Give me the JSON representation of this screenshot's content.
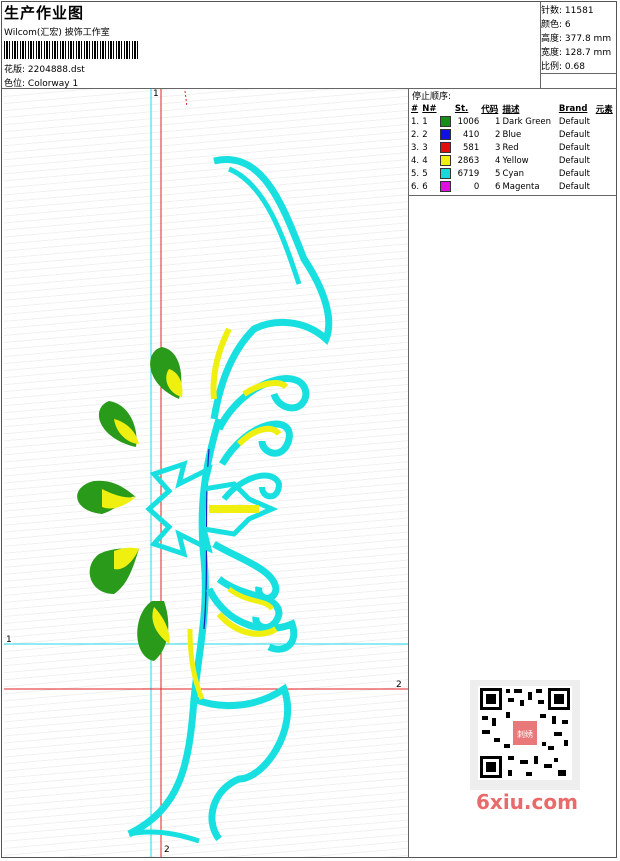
{
  "header": {
    "title": "生产作业图",
    "studio": "Wilcom(汇宏) 披饰工作室",
    "design_label": "花版:",
    "design_file": "2204888.dst",
    "colorway_label": "色位:",
    "colorway": "Colorway 1"
  },
  "stats": {
    "stitches_label": "针数:",
    "stitches": "11581",
    "colors_label": "颜色:",
    "colors": "6",
    "height_label": "高度:",
    "height": "377.8 mm",
    "width_label": "宽度:",
    "width": "128.7 mm",
    "scale_label": "比例:",
    "scale": "0.68"
  },
  "stop_sequence": {
    "title": "停止顺序:",
    "columns": [
      "#",
      "N#",
      "St.",
      "代码",
      "描述",
      "Brand",
      "元素"
    ],
    "rows": [
      {
        "idx": "1.",
        "n": "1",
        "color": "#1a8c1a",
        "st": "1006",
        "code": "1",
        "desc": "Dark Green",
        "brand": "Default"
      },
      {
        "idx": "2.",
        "n": "2",
        "color": "#1010e0",
        "st": "410",
        "code": "2",
        "desc": "Blue",
        "brand": "Default"
      },
      {
        "idx": "3.",
        "n": "3",
        "color": "#e01010",
        "st": "581",
        "code": "3",
        "desc": "Red",
        "brand": "Default"
      },
      {
        "idx": "4.",
        "n": "4",
        "color": "#f0f010",
        "st": "2863",
        "code": "4",
        "desc": "Yellow",
        "brand": "Default"
      },
      {
        "idx": "5.",
        "n": "5",
        "color": "#18d8d8",
        "st": "6719",
        "code": "5",
        "desc": "Cyan",
        "brand": "Default"
      },
      {
        "idx": "6.",
        "n": "6",
        "color": "#e010e0",
        "st": "0",
        "code": "6",
        "desc": "Magenta",
        "brand": "Default"
      }
    ]
  },
  "axes": {
    "v1": "1",
    "h1": "1",
    "h2": "2",
    "v2": "2"
  },
  "watermark": "6xiu.com",
  "qr_badge": "刺绣"
}
